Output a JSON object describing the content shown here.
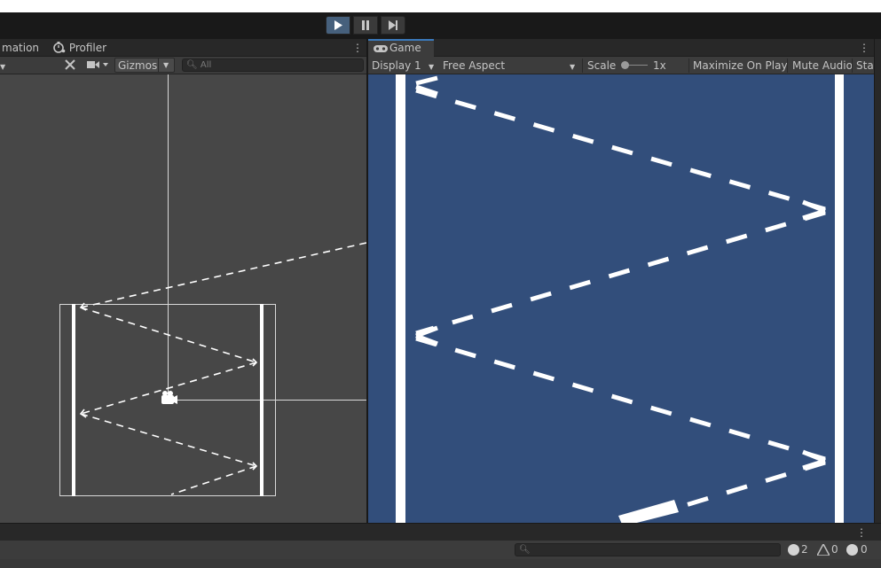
{
  "playbar": {
    "play_icon": "play-icon",
    "pause_icon": "pause-icon",
    "step_icon": "step-icon"
  },
  "scene_tabs": {
    "animation_label": "mation",
    "profiler_label": "Profiler"
  },
  "scene_toolbar": {
    "gizmos_label": "Gizmos",
    "search_placeholder": "All"
  },
  "game_tabs": {
    "game_label": "Game"
  },
  "game_toolbar": {
    "display_label": "Display 1",
    "aspect_label": "Free Aspect",
    "scale_label": "Scale",
    "scale_value": "1x",
    "maximize_label": "Maximize On Play",
    "mute_label": "Mute Audio",
    "stats_label": "Sta"
  },
  "console": {
    "error_count": "2",
    "warning_count": "0",
    "info_count": "0"
  },
  "colors": {
    "game_background": "#324e7b",
    "scene_background": "#474747",
    "play_active": "#46607c"
  }
}
